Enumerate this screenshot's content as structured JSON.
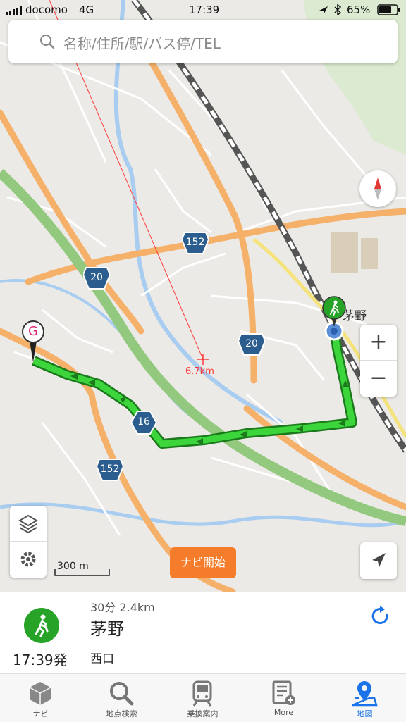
{
  "status": {
    "carrier": "docomo",
    "network": "4G",
    "time": "17:39",
    "battery": "65%"
  },
  "search": {
    "placeholder": "名称/住所/駅/バス停/TEL"
  },
  "map": {
    "route_shields": [
      {
        "number": "152"
      },
      {
        "number": "20"
      },
      {
        "number": "20"
      },
      {
        "number": "16"
      },
      {
        "number": "152"
      }
    ],
    "distance_label": "6.7km",
    "station_label": "茅野",
    "goal_label": "G",
    "scale_label": "300 m",
    "nav_start_label": "ナビ開始",
    "zoom_in": "+",
    "zoom_out": "−"
  },
  "route_panel": {
    "duration_distance": "30分 2.4km",
    "destination": "茅野",
    "exit": "西口",
    "depart_time": "17:39発"
  },
  "tabs": [
    {
      "label": "ナビ",
      "icon": "navi-cube-icon"
    },
    {
      "label": "地点検索",
      "icon": "search-icon"
    },
    {
      "label": "乗換案内",
      "icon": "train-icon"
    },
    {
      "label": "More",
      "icon": "more-list-icon"
    },
    {
      "label": "地図",
      "icon": "map-pin-icon",
      "active": true
    }
  ],
  "colors": {
    "route": "#3cd63c",
    "accent": "#1a73e8",
    "orange": "#f47c2a",
    "walk_green": "#27a327"
  }
}
